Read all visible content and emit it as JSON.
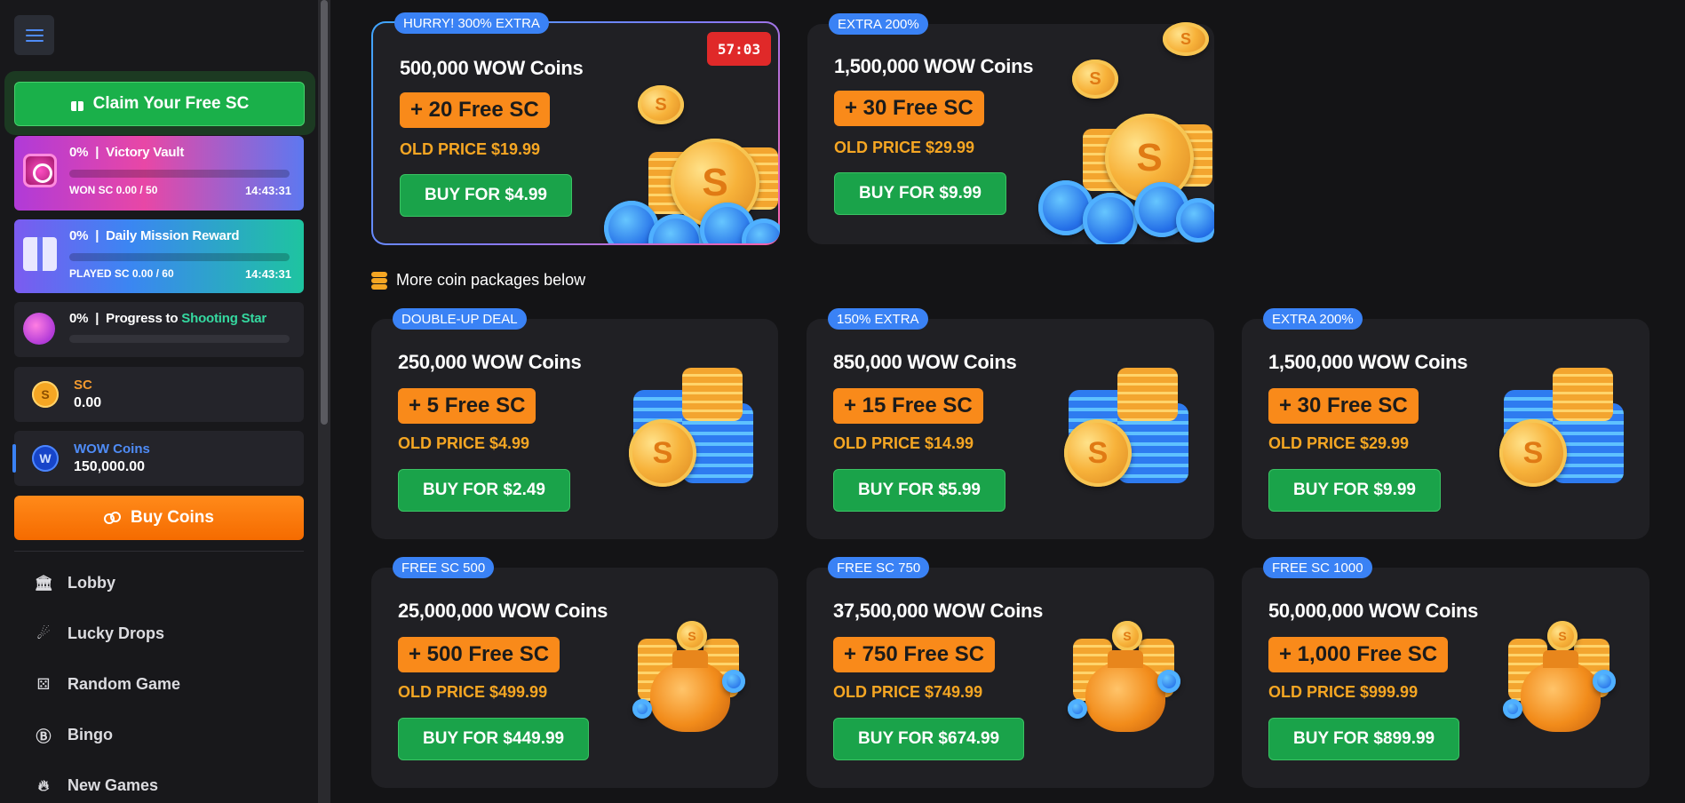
{
  "sidebar": {
    "claim_label": "Claim Your Free SC",
    "vault": {
      "percent": "0%",
      "name": "Victory Vault",
      "sub": "WON SC 0.00 / 50",
      "time": "14:43:31",
      "progress": 0
    },
    "mission": {
      "percent": "0%",
      "name": "Daily Mission Reward",
      "sub": "PLAYED SC 0.00 / 60",
      "time": "14:43:31",
      "progress": 0
    },
    "star": {
      "percent": "0%",
      "prefix": "Progress to",
      "highlight": "Shooting Star",
      "progress": 0
    },
    "sc": {
      "icon_letter": "S",
      "label": "SC",
      "value": "0.00"
    },
    "wow": {
      "icon_letter": "W",
      "label": "WOW Coins",
      "value": "150,000.00"
    },
    "buy_coins_label": "Buy Coins",
    "nav": [
      {
        "label": "Lobby",
        "icon": "lobby-icon"
      },
      {
        "label": "Lucky Drops",
        "icon": "lucky-drops-icon"
      },
      {
        "label": "Random Game",
        "icon": "random-game-icon"
      },
      {
        "label": "Bingo",
        "icon": "bingo-icon"
      },
      {
        "label": "New Games",
        "icon": "new-games-icon"
      }
    ]
  },
  "featured": [
    {
      "badge": "HURRY! 300% EXTRA",
      "title": "500,000 WOW Coins",
      "free_sc": "+ 20 Free SC",
      "old_price": "OLD PRICE $19.99",
      "buy": "BUY FOR $4.99",
      "timer": "57:03"
    },
    {
      "badge": "EXTRA 200%",
      "title": "1,500,000 WOW Coins",
      "free_sc": "+ 30 Free SC",
      "old_price": "OLD PRICE $29.99",
      "buy": "BUY FOR $9.99"
    }
  ],
  "more_label": "More coin packages below",
  "packages": [
    {
      "badge": "DOUBLE-UP DEAL",
      "title": "250,000 WOW Coins",
      "free_sc": "+ 5 Free SC",
      "old_price": "OLD PRICE $4.99",
      "buy": "BUY FOR $2.49"
    },
    {
      "badge": "150% EXTRA",
      "title": "850,000 WOW Coins",
      "free_sc": "+ 15 Free SC",
      "old_price": "OLD PRICE $14.99",
      "buy": "BUY FOR $5.99"
    },
    {
      "badge": "EXTRA 200%",
      "title": "1,500,000 WOW Coins",
      "free_sc": "+ 30 Free SC",
      "old_price": "OLD PRICE $29.99",
      "buy": "BUY FOR $9.99"
    },
    {
      "badge": "FREE SC 500",
      "title": "25,000,000 WOW Coins",
      "free_sc": "+ 500 Free SC",
      "old_price": "OLD PRICE $499.99",
      "buy": "BUY FOR $449.99"
    },
    {
      "badge": "FREE SC 750",
      "title": "37,500,000 WOW Coins",
      "free_sc": "+ 750 Free SC",
      "old_price": "OLD PRICE $749.99",
      "buy": "BUY FOR $674.99"
    },
    {
      "badge": "FREE SC 1000",
      "title": "50,000,000 WOW Coins",
      "free_sc": "+ 1,000 Free SC",
      "old_price": "OLD PRICE $999.99",
      "buy": "BUY FOR $899.99"
    }
  ],
  "colors": {
    "accent_blue": "#3a82f5",
    "green": "#1aa34a",
    "orange": "#f98a1a",
    "old_price": "#f5a623"
  }
}
